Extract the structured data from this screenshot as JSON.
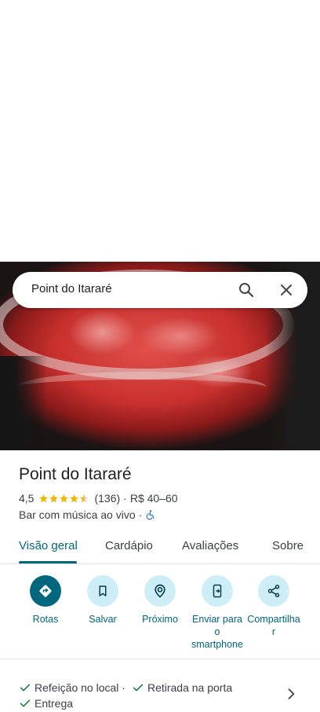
{
  "search": {
    "query": "Point do Itararé"
  },
  "place": {
    "name": "Point do Itararé",
    "rating": "4,5",
    "stars": 4.5,
    "reviews": "(136)",
    "separator": "·",
    "price": "R$ 40–60",
    "category": "Bar com música ao vivo",
    "category_sep": "·"
  },
  "tabs": [
    {
      "label": "Visão geral"
    },
    {
      "label": "Cardápio"
    },
    {
      "label": "Avaliações"
    },
    {
      "label": "Sobre"
    }
  ],
  "actions": [
    {
      "label": "Rotas",
      "icon": "directions-icon"
    },
    {
      "label": "Salvar",
      "icon": "bookmark-icon"
    },
    {
      "label": "Próximo",
      "icon": "nearby-icon"
    },
    {
      "label_lines": [
        "Enviar para",
        "o",
        "smartphone"
      ],
      "icon": "send-to-phone-icon"
    },
    {
      "label_lines": [
        "Compartilha",
        "r"
      ],
      "icon": "share-icon"
    }
  ],
  "services": {
    "dine_in": "Refeição no local ·",
    "curbside": "Retirada na porta",
    "delivery": "Entrega"
  },
  "colors": {
    "accent": "#00677d",
    "star": "#f4b400",
    "check": "#188038",
    "chip": "#cdeef6",
    "accessible": "#1a73e8"
  }
}
